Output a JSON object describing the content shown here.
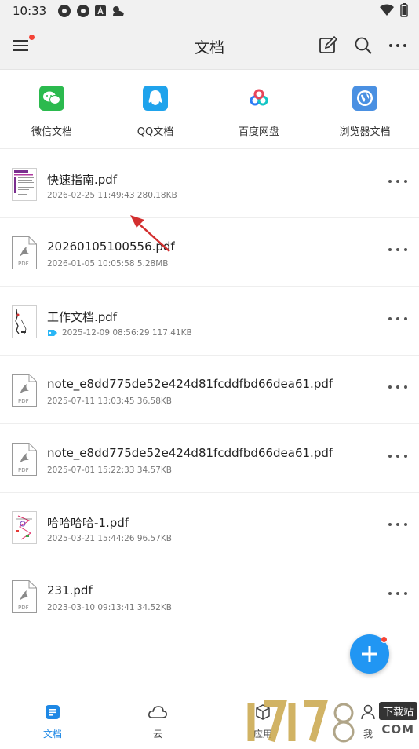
{
  "status_bar": {
    "time": "10:33"
  },
  "app_bar": {
    "title": "文档"
  },
  "sources": [
    {
      "label": "微信文档",
      "icon": "wechat-icon",
      "color": "#2bba4e"
    },
    {
      "label": "QQ文档",
      "icon": "qq-icon",
      "color": "#1fa3ec"
    },
    {
      "label": "百度网盘",
      "icon": "baidu-netdisk-icon",
      "color": "#ffffff"
    },
    {
      "label": "浏览器文档",
      "icon": "browser-icon",
      "color": "#4a90e2"
    }
  ],
  "files": [
    {
      "name": "快速指南.pdf",
      "meta": "2026-02-25 11:49:43 280.18KB",
      "thumb": "guide-thumbnail"
    },
    {
      "name": "20260105100556.pdf",
      "meta": "2026-01-05 10:05:58 5.28MB",
      "thumb": "pdf-icon"
    },
    {
      "name": "工作文档.pdf",
      "meta": "2025-12-09 08:56:29 117.41KB",
      "thumb": "document-thumbnail",
      "tagged": true
    },
    {
      "name": "note_e8dd775de52e424d81fcddfbd66dea61.pdf",
      "meta": "2025-07-11 13:03:45 36.58KB",
      "thumb": "pdf-icon"
    },
    {
      "name": "note_e8dd775de52e424d81fcddfbd66dea61.pdf",
      "meta": "2025-07-01 15:22:33 34.57KB",
      "thumb": "pdf-icon"
    },
    {
      "name": "哈哈哈哈-1.pdf",
      "meta": "2025-03-21 15:44:26 96.57KB",
      "thumb": "sketch-thumbnail"
    },
    {
      "name": "231.pdf",
      "meta": "2023-03-10 09:13:41 34.52KB",
      "thumb": "pdf-icon"
    }
  ],
  "pdf_label": "PDF",
  "bottom_nav": [
    {
      "label": "文档",
      "active": true
    },
    {
      "label": "云",
      "active": false
    },
    {
      "label": "应用",
      "active": false
    },
    {
      "label": "我",
      "active": false
    }
  ],
  "watermark": {
    "badge": "下载站",
    "domain": "COM",
    "logo": "17178"
  },
  "colors": {
    "accent": "#1e88e5",
    "fab": "#2196f3",
    "notify": "#f44336",
    "arrow": "#d32f2f"
  }
}
